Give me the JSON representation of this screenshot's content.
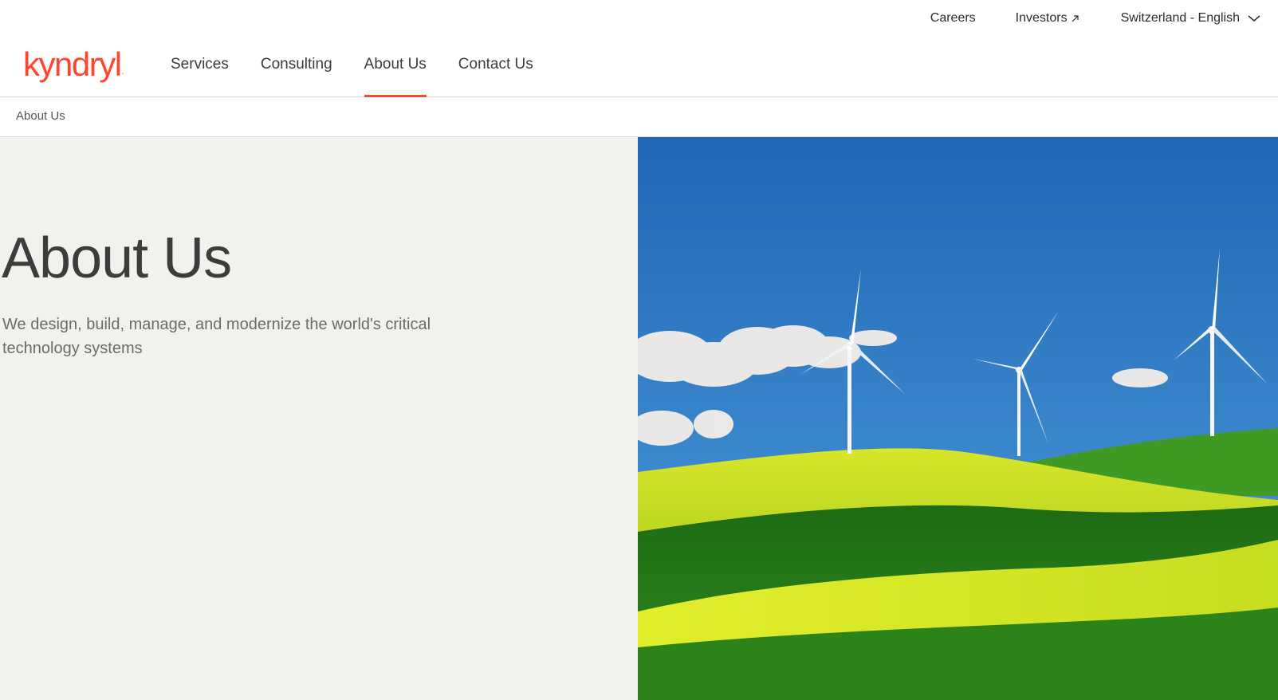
{
  "utility_nav": {
    "careers": "Careers",
    "investors": "Investors",
    "locale": "Switzerland - English"
  },
  "brand": {
    "logo_text": "kyndryl",
    "accent_color": "#ff462d"
  },
  "main_nav": {
    "items": [
      {
        "label": "Services"
      },
      {
        "label": "Consulting"
      },
      {
        "label": "About Us",
        "active": true
      },
      {
        "label": "Contact Us"
      }
    ]
  },
  "breadcrumb": {
    "current": "About Us"
  },
  "hero": {
    "title": "About Us",
    "subtitle": "We design, build, manage, and modernize the world's critical technology systems"
  },
  "icons": [
    "external-link-icon",
    "chevron-down-icon"
  ]
}
